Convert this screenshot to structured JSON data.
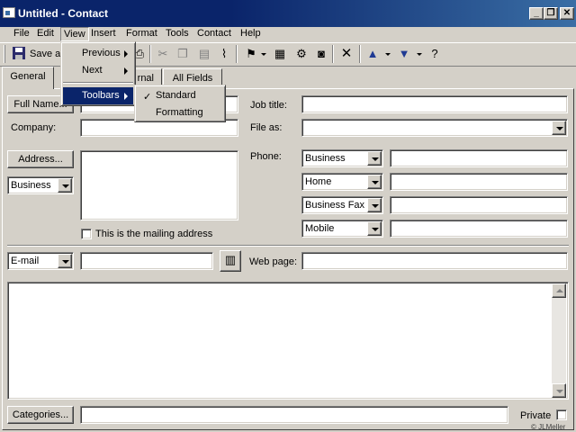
{
  "window": {
    "title": "Untitled - Contact",
    "minimize": "_",
    "restore": "❐",
    "close": "✕"
  },
  "menubar": [
    "File",
    "Edit",
    "View",
    "Insert",
    "Format",
    "Tools",
    "Contact",
    "Help"
  ],
  "toolbar": {
    "save_label": "Save a"
  },
  "tabs": [
    "General",
    "rnal",
    "All Fields"
  ],
  "view_menu": {
    "previous": "Previous",
    "next": "Next",
    "toolbars": "Toolbars"
  },
  "toolbars_submenu": {
    "standard": "Standard",
    "formatting": "Formatting",
    "check": "✓"
  },
  "form": {
    "full_name_button": "Full Name...",
    "company_label": "Company:",
    "address_button": "Address...",
    "address_type": "Business",
    "mailing_checkbox_label": "This is the mailing address",
    "job_title_label": "Job title:",
    "file_as_label": "File as:",
    "phone_label": "Phone:",
    "phones": [
      "Business",
      "Home",
      "Business Fax",
      "Mobile"
    ],
    "email_type": "E-mail",
    "web_page_label": "Web page:",
    "categories_button": "Categories...",
    "private_label": "Private"
  },
  "watermark": "© JLMeller"
}
